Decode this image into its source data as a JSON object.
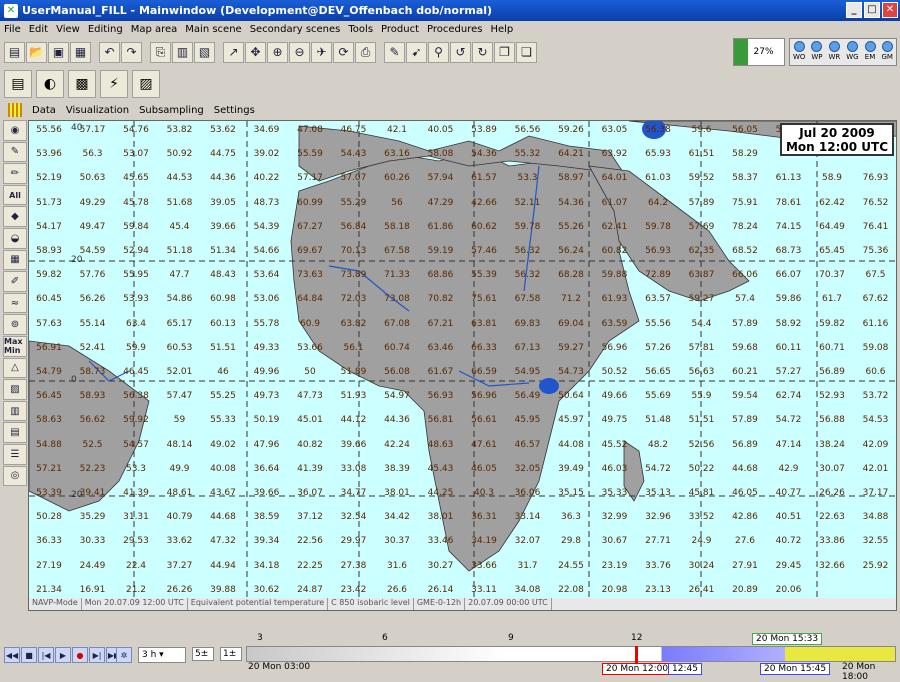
{
  "window": {
    "title": "UserManual_FILL - Mainwindow (Development@DEV_Offenbach dob/normal)",
    "minimize": "_",
    "maximize": "□",
    "close": "✕"
  },
  "menu": [
    "File",
    "Edit",
    "View",
    "Editing",
    "Map area",
    "Main scene",
    "Secondary scenes",
    "Tools",
    "Product",
    "Procedures",
    "Help"
  ],
  "toolbar": {
    "icons": [
      "new-doc",
      "open",
      "save",
      "save-as",
      "print",
      "undo",
      "redo",
      "copy",
      "paste",
      "select",
      "move",
      "zoom-in",
      "zoom-out",
      "pan",
      "refresh",
      "print-map",
      "pen",
      "pointer",
      "pin",
      "undo-edit",
      "redo-edit",
      "copy-edit",
      "paste-edit"
    ],
    "progress_percent": 27,
    "progress_label": "27%",
    "status_lights": [
      "WO",
      "WP",
      "WR",
      "WG",
      "EM",
      "GM"
    ]
  },
  "submenu": [
    "Data",
    "Visualization",
    "Subsampling",
    "Settings"
  ],
  "sidebar": {
    "all_label": "All",
    "max_label": "Max Min"
  },
  "map": {
    "date_line1": "Jul 20 2009",
    "date_line2": "Mon 12:00 UTC",
    "lat_labels": [
      "40",
      "20",
      "0",
      "20",
      "40",
      "40",
      "20",
      "0",
      "20",
      "40"
    ],
    "status": [
      "NAVP-Mode",
      "Mon 20.07.09 12:00 UTC",
      "Equivalent potential temperature",
      "C 850 isobaric level",
      "GME-0-12h",
      "20.07.09 00:00 UTC"
    ],
    "values": [
      [
        "55.56",
        "57.17",
        "54.76",
        "53.82",
        "53.62",
        "34.69",
        "47.08",
        "46.75",
        "42.1",
        "40.05",
        "53.89",
        "56.56",
        "59.26",
        "63.05",
        "56.38",
        "59.6",
        "56.05",
        "55.49"
      ],
      [
        "53.96",
        "56.3",
        "53.07",
        "50.92",
        "44.75",
        "39.02",
        "55.59",
        "54.43",
        "63.16",
        "58.08",
        "54.36",
        "55.32",
        "64.21",
        "63.92",
        "65.93",
        "61.51",
        "58.29",
        ""
      ],
      [
        "52.19",
        "50.63",
        "45.65",
        "44.53",
        "44.36",
        "40.22",
        "57.17",
        "57.07",
        "60.26",
        "57.94",
        "61.57",
        "53.3",
        "58.97",
        "64.01",
        "61.03",
        "59.52",
        "58.37",
        "61.13"
      ],
      [
        "51.73",
        "49.29",
        "45.78",
        "51.68",
        "39.05",
        "48.73",
        "60.99",
        "55.29",
        "56",
        "47.29",
        "42.66",
        "52.11",
        "54.36",
        "61.07",
        "64.2",
        "57.89",
        "75.91",
        "78.61"
      ],
      [
        "54.17",
        "49.47",
        "59.84",
        "45.4",
        "39.66",
        "54.39",
        "67.27",
        "56.84",
        "58.18",
        "61.86",
        "60.62",
        "59.78",
        "55.26",
        "62.41",
        "59.78",
        "57.69",
        "78.24",
        "74.15"
      ],
      [
        "58.93",
        "54.59",
        "52.94",
        "51.18",
        "51.34",
        "54.66",
        "69.67",
        "70.13",
        "67.58",
        "59.19",
        "57.46",
        "56.32",
        "56.24",
        "60.82",
        "56.93",
        "62.35",
        "68.52",
        "68.73"
      ],
      [
        "59.82",
        "57.76",
        "55.95",
        "47.7",
        "48.43",
        "53.64",
        "73.63",
        "73.89",
        "71.33",
        "68.86",
        "55.39",
        "56.32",
        "68.28",
        "59.88",
        "72.89",
        "63.87",
        "66.06",
        "66.07"
      ],
      [
        "60.45",
        "56.26",
        "53.93",
        "54.86",
        "60.98",
        "53.06",
        "64.84",
        "72.03",
        "73.08",
        "70.82",
        "75.61",
        "67.58",
        "71.2",
        "61.93",
        "63.57",
        "59.27",
        "57.4",
        "59.86"
      ],
      [
        "57.63",
        "55.14",
        "63.4",
        "65.17",
        "60.13",
        "55.78",
        "60.9",
        "63.82",
        "67.08",
        "67.21",
        "63.81",
        "69.83",
        "69.04",
        "63.59",
        "55.56",
        "54.4",
        "57.89",
        "58.92"
      ],
      [
        "56.91",
        "52.41",
        "59.9",
        "60.53",
        "51.51",
        "49.33",
        "53.66",
        "56.1",
        "60.74",
        "63.46",
        "66.33",
        "67.13",
        "59.27",
        "56.96",
        "57.26",
        "57.81",
        "59.68",
        "60.11"
      ],
      [
        "54.79",
        "58.73",
        "46.45",
        "52.01",
        "46",
        "49.96",
        "50",
        "51.89",
        "56.08",
        "61.67",
        "66.59",
        "54.95",
        "54.73",
        "50.52",
        "56.65",
        "56.63",
        "60.21",
        "57.27"
      ],
      [
        "56.45",
        "58.93",
        "56.38",
        "57.47",
        "55.25",
        "49.73",
        "47.73",
        "51.93",
        "54.97",
        "56.93",
        "56.96",
        "56.49",
        "50.64",
        "49.66",
        "55.69",
        "55.9",
        "59.54",
        "62.74"
      ],
      [
        "58.63",
        "56.62",
        "59.92",
        "59",
        "55.33",
        "50.19",
        "45.01",
        "44.12",
        "44.36",
        "56.81",
        "56.61",
        "45.95",
        "45.97",
        "49.75",
        "51.48",
        "51.51",
        "57.89",
        "54.72"
      ],
      [
        "54.88",
        "52.5",
        "54.57",
        "48.14",
        "49.02",
        "47.96",
        "40.82",
        "39.66",
        "42.24",
        "48.63",
        "47.61",
        "46.57",
        "44.08",
        "45.52",
        "48.2",
        "52.56",
        "56.89",
        "47.14"
      ],
      [
        "57.21",
        "52.23",
        "53.3",
        "49.9",
        "40.08",
        "36.64",
        "41.39",
        "33.08",
        "38.39",
        "45.43",
        "46.05",
        "32.05",
        "39.49",
        "46.03",
        "54.72",
        "50.22",
        "44.68",
        "42.9"
      ],
      [
        "53.39",
        "39.41",
        "41.39",
        "48.61",
        "43.67",
        "39.66",
        "36.07",
        "34.77",
        "38.01",
        "44.25",
        "40.3",
        "36.06",
        "35.15",
        "35.33",
        "35.13",
        "45.81",
        "46.05",
        "40.77"
      ],
      [
        "50.28",
        "35.29",
        "31.31",
        "40.79",
        "44.68",
        "38.59",
        "37.12",
        "32.54",
        "34.42",
        "38.01",
        "36.31",
        "33.14",
        "36.3",
        "32.99",
        "32.96",
        "33.52",
        "42.86",
        "40.51"
      ],
      [
        "36.33",
        "30.33",
        "29.53",
        "33.62",
        "47.32",
        "39.34",
        "22.56",
        "29.97",
        "30.37",
        "33.46",
        "34.19",
        "32.07",
        "29.8",
        "30.67",
        "27.71",
        "24.9",
        "27.6",
        "40.72"
      ],
      [
        "27.19",
        "24.49",
        "22.4",
        "37.27",
        "44.94",
        "34.18",
        "22.25",
        "27.38",
        "31.6",
        "30.27",
        "33.66",
        "31.7",
        "24.55",
        "23.19",
        "33.76",
        "30.24",
        "27.91",
        "29.45"
      ],
      [
        "21.34",
        "16.91",
        "21.2",
        "26.26",
        "39.88",
        "30.62",
        "24.87",
        "23.42",
        "26.6",
        "26.14",
        "33.11",
        "34.08",
        "22.08",
        "20.98",
        "23.13",
        "26.41",
        "20.89",
        "20.06"
      ]
    ],
    "right_values": [
      "55.66",
      "58.9",
      "62.42",
      "64.49",
      "65.45",
      "70.37",
      "61.7",
      "59.82",
      "60.71",
      "56.89",
      "52.93",
      "56.88",
      "38.24",
      "30.07",
      "26.26",
      "22.63",
      "33.86",
      "32.66",
      "55.92",
      "47.33",
      "76.93",
      "76.52",
      "76.41",
      "75.36",
      "67.5",
      "67.62",
      "61.16",
      "59.08",
      "60.6",
      "53.72",
      "54.53",
      "42.09",
      "42.01",
      "37.17",
      "34.88",
      "32.55",
      "25.92"
    ]
  },
  "timeline": {
    "step": "3 h",
    "spin1": "5",
    "spin2": "1",
    "ticks": [
      "3",
      "6",
      "9",
      "12"
    ],
    "start_label": "20 Mon 03:00",
    "current_label": "20 Mon 12:00",
    "mark_1245": "12:45",
    "mark_1545": "20 Mon 15:45",
    "top_label": "20 Mon 15:33",
    "end_label": "20 Mon 18:00"
  }
}
